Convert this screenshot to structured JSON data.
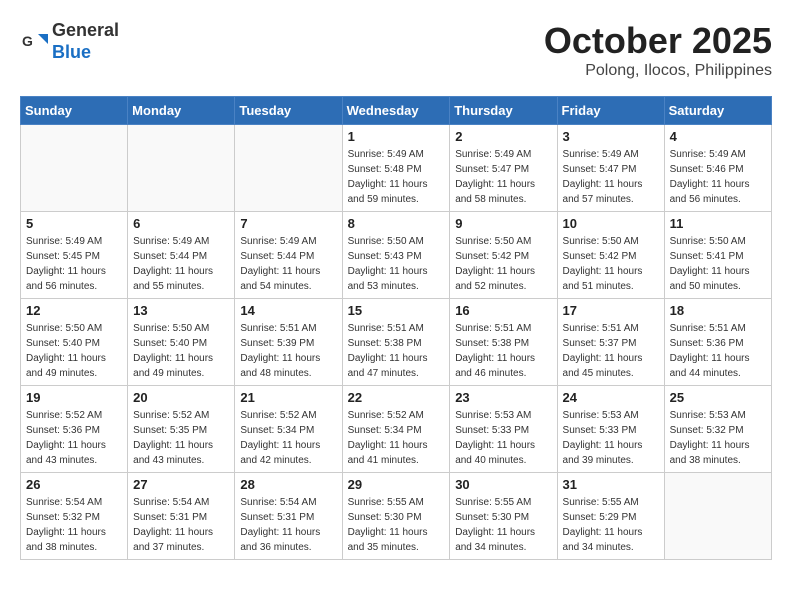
{
  "header": {
    "logo_line1": "General",
    "logo_line2": "Blue",
    "month": "October 2025",
    "location": "Polong, Ilocos, Philippines"
  },
  "days_of_week": [
    "Sunday",
    "Monday",
    "Tuesday",
    "Wednesday",
    "Thursday",
    "Friday",
    "Saturday"
  ],
  "weeks": [
    [
      {
        "day": "",
        "info": ""
      },
      {
        "day": "",
        "info": ""
      },
      {
        "day": "",
        "info": ""
      },
      {
        "day": "1",
        "info": "Sunrise: 5:49 AM\nSunset: 5:48 PM\nDaylight: 11 hours\nand 59 minutes."
      },
      {
        "day": "2",
        "info": "Sunrise: 5:49 AM\nSunset: 5:47 PM\nDaylight: 11 hours\nand 58 minutes."
      },
      {
        "day": "3",
        "info": "Sunrise: 5:49 AM\nSunset: 5:47 PM\nDaylight: 11 hours\nand 57 minutes."
      },
      {
        "day": "4",
        "info": "Sunrise: 5:49 AM\nSunset: 5:46 PM\nDaylight: 11 hours\nand 56 minutes."
      }
    ],
    [
      {
        "day": "5",
        "info": "Sunrise: 5:49 AM\nSunset: 5:45 PM\nDaylight: 11 hours\nand 56 minutes."
      },
      {
        "day": "6",
        "info": "Sunrise: 5:49 AM\nSunset: 5:44 PM\nDaylight: 11 hours\nand 55 minutes."
      },
      {
        "day": "7",
        "info": "Sunrise: 5:49 AM\nSunset: 5:44 PM\nDaylight: 11 hours\nand 54 minutes."
      },
      {
        "day": "8",
        "info": "Sunrise: 5:50 AM\nSunset: 5:43 PM\nDaylight: 11 hours\nand 53 minutes."
      },
      {
        "day": "9",
        "info": "Sunrise: 5:50 AM\nSunset: 5:42 PM\nDaylight: 11 hours\nand 52 minutes."
      },
      {
        "day": "10",
        "info": "Sunrise: 5:50 AM\nSunset: 5:42 PM\nDaylight: 11 hours\nand 51 minutes."
      },
      {
        "day": "11",
        "info": "Sunrise: 5:50 AM\nSunset: 5:41 PM\nDaylight: 11 hours\nand 50 minutes."
      }
    ],
    [
      {
        "day": "12",
        "info": "Sunrise: 5:50 AM\nSunset: 5:40 PM\nDaylight: 11 hours\nand 49 minutes."
      },
      {
        "day": "13",
        "info": "Sunrise: 5:50 AM\nSunset: 5:40 PM\nDaylight: 11 hours\nand 49 minutes."
      },
      {
        "day": "14",
        "info": "Sunrise: 5:51 AM\nSunset: 5:39 PM\nDaylight: 11 hours\nand 48 minutes."
      },
      {
        "day": "15",
        "info": "Sunrise: 5:51 AM\nSunset: 5:38 PM\nDaylight: 11 hours\nand 47 minutes."
      },
      {
        "day": "16",
        "info": "Sunrise: 5:51 AM\nSunset: 5:38 PM\nDaylight: 11 hours\nand 46 minutes."
      },
      {
        "day": "17",
        "info": "Sunrise: 5:51 AM\nSunset: 5:37 PM\nDaylight: 11 hours\nand 45 minutes."
      },
      {
        "day": "18",
        "info": "Sunrise: 5:51 AM\nSunset: 5:36 PM\nDaylight: 11 hours\nand 44 minutes."
      }
    ],
    [
      {
        "day": "19",
        "info": "Sunrise: 5:52 AM\nSunset: 5:36 PM\nDaylight: 11 hours\nand 43 minutes."
      },
      {
        "day": "20",
        "info": "Sunrise: 5:52 AM\nSunset: 5:35 PM\nDaylight: 11 hours\nand 43 minutes."
      },
      {
        "day": "21",
        "info": "Sunrise: 5:52 AM\nSunset: 5:34 PM\nDaylight: 11 hours\nand 42 minutes."
      },
      {
        "day": "22",
        "info": "Sunrise: 5:52 AM\nSunset: 5:34 PM\nDaylight: 11 hours\nand 41 minutes."
      },
      {
        "day": "23",
        "info": "Sunrise: 5:53 AM\nSunset: 5:33 PM\nDaylight: 11 hours\nand 40 minutes."
      },
      {
        "day": "24",
        "info": "Sunrise: 5:53 AM\nSunset: 5:33 PM\nDaylight: 11 hours\nand 39 minutes."
      },
      {
        "day": "25",
        "info": "Sunrise: 5:53 AM\nSunset: 5:32 PM\nDaylight: 11 hours\nand 38 minutes."
      }
    ],
    [
      {
        "day": "26",
        "info": "Sunrise: 5:54 AM\nSunset: 5:32 PM\nDaylight: 11 hours\nand 38 minutes."
      },
      {
        "day": "27",
        "info": "Sunrise: 5:54 AM\nSunset: 5:31 PM\nDaylight: 11 hours\nand 37 minutes."
      },
      {
        "day": "28",
        "info": "Sunrise: 5:54 AM\nSunset: 5:31 PM\nDaylight: 11 hours\nand 36 minutes."
      },
      {
        "day": "29",
        "info": "Sunrise: 5:55 AM\nSunset: 5:30 PM\nDaylight: 11 hours\nand 35 minutes."
      },
      {
        "day": "30",
        "info": "Sunrise: 5:55 AM\nSunset: 5:30 PM\nDaylight: 11 hours\nand 34 minutes."
      },
      {
        "day": "31",
        "info": "Sunrise: 5:55 AM\nSunset: 5:29 PM\nDaylight: 11 hours\nand 34 minutes."
      },
      {
        "day": "",
        "info": ""
      }
    ]
  ]
}
